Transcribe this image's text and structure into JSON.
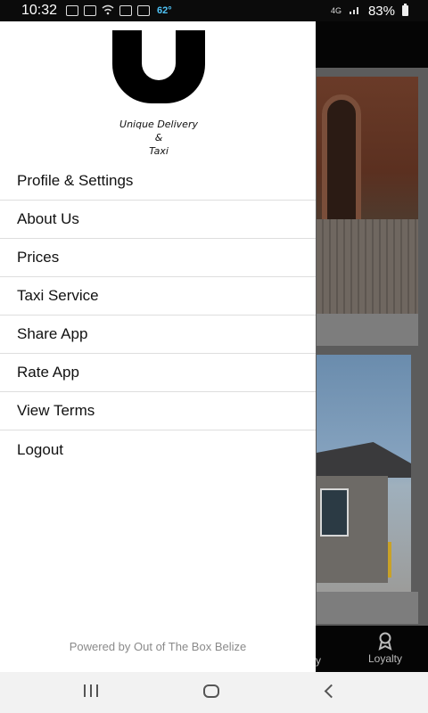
{
  "status_bar": {
    "time": "10:32",
    "temperature": "62°",
    "network_label": "4G",
    "battery_percent": "83%"
  },
  "drawer": {
    "logo": {
      "letter": "U",
      "line1": "Unique Delivery",
      "line2": "&",
      "line3": "Taxi"
    },
    "menu_items": [
      {
        "label": "Profile & Settings"
      },
      {
        "label": "About Us"
      },
      {
        "label": "Prices"
      },
      {
        "label": "Taxi Service"
      },
      {
        "label": "Share App"
      },
      {
        "label": "Rate App"
      },
      {
        "label": "View Terms"
      },
      {
        "label": "Logout"
      }
    ],
    "footer": "Powered by Out of The Box Belize"
  },
  "background_app": {
    "bottom_tabs": {
      "partial_label": "y",
      "loyalty_label": "Loyalty"
    }
  },
  "colors": {
    "drawer_bg": "#ffffff",
    "menu_text": "#111111",
    "footer_text": "#8a8a8a",
    "app_header": "#050505"
  }
}
